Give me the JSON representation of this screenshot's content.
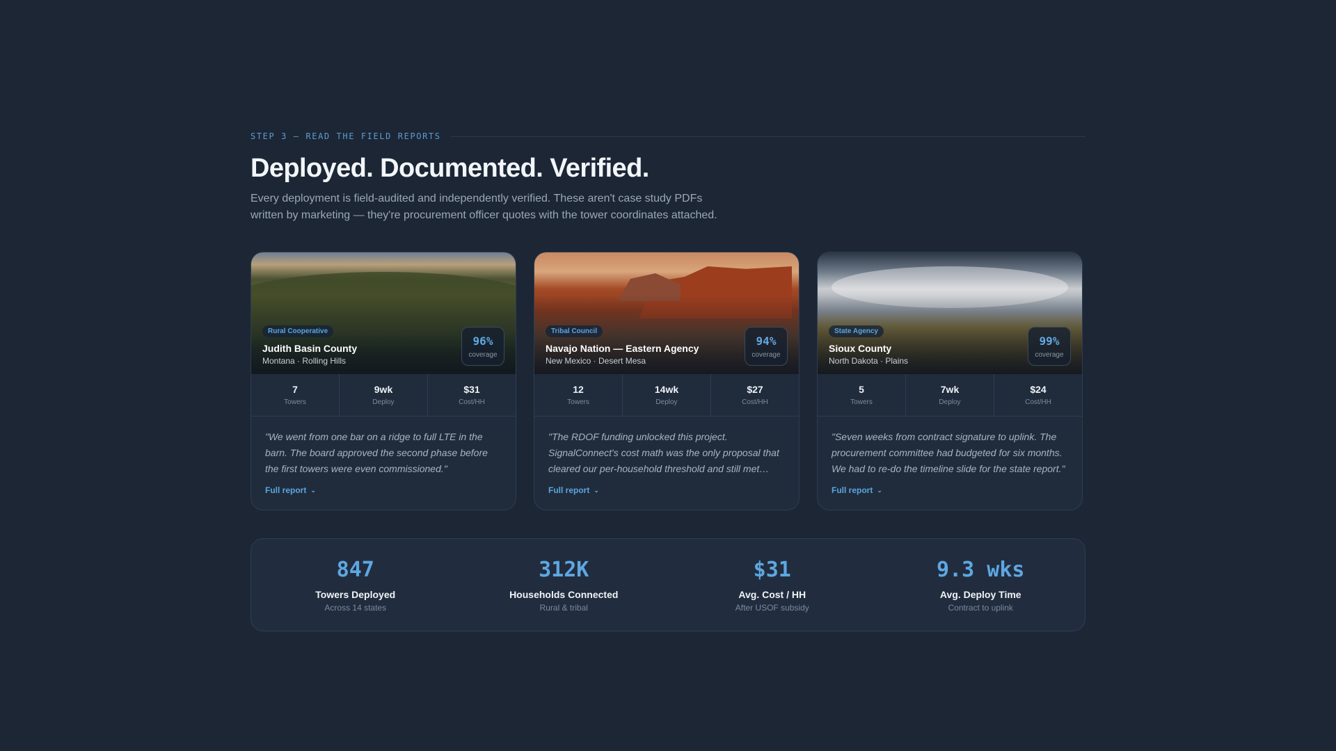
{
  "header": {
    "eyebrow": "STEP 3 — READ THE FIELD REPORTS",
    "title": "Deployed. Documented. Verified.",
    "lede": "Every deployment is field-audited and independently verified. These aren't case study PDFs written by marketing — they're procurement officer quotes with the tower coordinates attached."
  },
  "cards": [
    {
      "badge": "Rural Cooperative",
      "title": "Judith Basin County",
      "subtitle": "Montana · Rolling Hills",
      "coverage": "96%",
      "coverage_label": "coverage",
      "stats": [
        {
          "value": "7",
          "label": "Towers"
        },
        {
          "value": "9wk",
          "label": "Deploy"
        },
        {
          "value": "$31",
          "label": "Cost/HH"
        }
      ],
      "quote": "\"We went from one bar on a ridge to full LTE in the barn. The board approved the second phase before the first towers were even commissioned.\"",
      "link": "Full report"
    },
    {
      "badge": "Tribal Council",
      "title": "Navajo Nation — Eastern Agency",
      "subtitle": "New Mexico · Desert Mesa",
      "coverage": "94%",
      "coverage_label": "coverage",
      "stats": [
        {
          "value": "12",
          "label": "Towers"
        },
        {
          "value": "14wk",
          "label": "Deploy"
        },
        {
          "value": "$27",
          "label": "Cost/HH"
        }
      ],
      "quote": "\"The RDOF funding unlocked this project. SignalConnect's cost math was the only proposal that cleared our per-household threshold and still met…",
      "link": "Full report"
    },
    {
      "badge": "State Agency",
      "title": "Sioux County",
      "subtitle": "North Dakota · Plains",
      "coverage": "99%",
      "coverage_label": "coverage",
      "stats": [
        {
          "value": "5",
          "label": "Towers"
        },
        {
          "value": "7wk",
          "label": "Deploy"
        },
        {
          "value": "$24",
          "label": "Cost/HH"
        }
      ],
      "quote": "\"Seven weeks from contract signature to uplink. The procurement committee had budgeted for six months. We had to re-do the timeline slide for the state report.\"",
      "link": "Full report"
    }
  ],
  "summary": [
    {
      "value": "847",
      "label": "Towers Deployed",
      "sub": "Across 14 states"
    },
    {
      "value": "312K",
      "label": "Households Connected",
      "sub": "Rural & tribal"
    },
    {
      "value": "$31",
      "label": "Avg. Cost / HH",
      "sub": "After USOF subsidy"
    },
    {
      "value": "9.3 wks",
      "label": "Avg. Deploy Time",
      "sub": "Contract to uplink"
    }
  ]
}
